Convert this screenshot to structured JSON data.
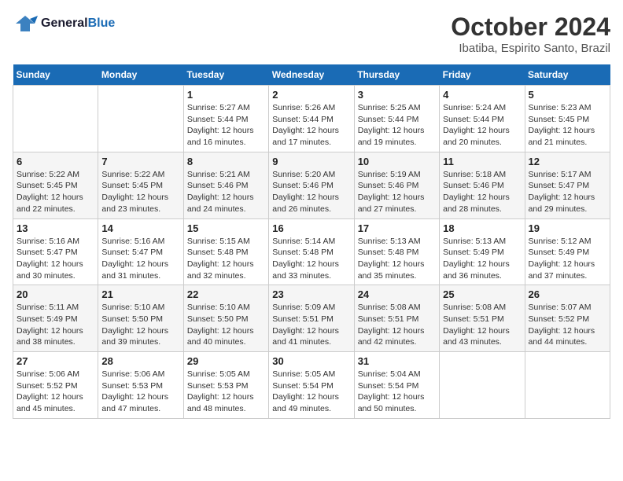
{
  "header": {
    "logo_line1": "General",
    "logo_line2": "Blue",
    "month": "October 2024",
    "location": "Ibatiba, Espirito Santo, Brazil"
  },
  "days_of_week": [
    "Sunday",
    "Monday",
    "Tuesday",
    "Wednesday",
    "Thursday",
    "Friday",
    "Saturday"
  ],
  "weeks": [
    [
      {
        "num": "",
        "sunrise": "",
        "sunset": "",
        "daylight": ""
      },
      {
        "num": "",
        "sunrise": "",
        "sunset": "",
        "daylight": ""
      },
      {
        "num": "1",
        "sunrise": "Sunrise: 5:27 AM",
        "sunset": "Sunset: 5:44 PM",
        "daylight": "Daylight: 12 hours and 16 minutes."
      },
      {
        "num": "2",
        "sunrise": "Sunrise: 5:26 AM",
        "sunset": "Sunset: 5:44 PM",
        "daylight": "Daylight: 12 hours and 17 minutes."
      },
      {
        "num": "3",
        "sunrise": "Sunrise: 5:25 AM",
        "sunset": "Sunset: 5:44 PM",
        "daylight": "Daylight: 12 hours and 19 minutes."
      },
      {
        "num": "4",
        "sunrise": "Sunrise: 5:24 AM",
        "sunset": "Sunset: 5:44 PM",
        "daylight": "Daylight: 12 hours and 20 minutes."
      },
      {
        "num": "5",
        "sunrise": "Sunrise: 5:23 AM",
        "sunset": "Sunset: 5:45 PM",
        "daylight": "Daylight: 12 hours and 21 minutes."
      }
    ],
    [
      {
        "num": "6",
        "sunrise": "Sunrise: 5:22 AM",
        "sunset": "Sunset: 5:45 PM",
        "daylight": "Daylight: 12 hours and 22 minutes."
      },
      {
        "num": "7",
        "sunrise": "Sunrise: 5:22 AM",
        "sunset": "Sunset: 5:45 PM",
        "daylight": "Daylight: 12 hours and 23 minutes."
      },
      {
        "num": "8",
        "sunrise": "Sunrise: 5:21 AM",
        "sunset": "Sunset: 5:46 PM",
        "daylight": "Daylight: 12 hours and 24 minutes."
      },
      {
        "num": "9",
        "sunrise": "Sunrise: 5:20 AM",
        "sunset": "Sunset: 5:46 PM",
        "daylight": "Daylight: 12 hours and 26 minutes."
      },
      {
        "num": "10",
        "sunrise": "Sunrise: 5:19 AM",
        "sunset": "Sunset: 5:46 PM",
        "daylight": "Daylight: 12 hours and 27 minutes."
      },
      {
        "num": "11",
        "sunrise": "Sunrise: 5:18 AM",
        "sunset": "Sunset: 5:46 PM",
        "daylight": "Daylight: 12 hours and 28 minutes."
      },
      {
        "num": "12",
        "sunrise": "Sunrise: 5:17 AM",
        "sunset": "Sunset: 5:47 PM",
        "daylight": "Daylight: 12 hours and 29 minutes."
      }
    ],
    [
      {
        "num": "13",
        "sunrise": "Sunrise: 5:16 AM",
        "sunset": "Sunset: 5:47 PM",
        "daylight": "Daylight: 12 hours and 30 minutes."
      },
      {
        "num": "14",
        "sunrise": "Sunrise: 5:16 AM",
        "sunset": "Sunset: 5:47 PM",
        "daylight": "Daylight: 12 hours and 31 minutes."
      },
      {
        "num": "15",
        "sunrise": "Sunrise: 5:15 AM",
        "sunset": "Sunset: 5:48 PM",
        "daylight": "Daylight: 12 hours and 32 minutes."
      },
      {
        "num": "16",
        "sunrise": "Sunrise: 5:14 AM",
        "sunset": "Sunset: 5:48 PM",
        "daylight": "Daylight: 12 hours and 33 minutes."
      },
      {
        "num": "17",
        "sunrise": "Sunrise: 5:13 AM",
        "sunset": "Sunset: 5:48 PM",
        "daylight": "Daylight: 12 hours and 35 minutes."
      },
      {
        "num": "18",
        "sunrise": "Sunrise: 5:13 AM",
        "sunset": "Sunset: 5:49 PM",
        "daylight": "Daylight: 12 hours and 36 minutes."
      },
      {
        "num": "19",
        "sunrise": "Sunrise: 5:12 AM",
        "sunset": "Sunset: 5:49 PM",
        "daylight": "Daylight: 12 hours and 37 minutes."
      }
    ],
    [
      {
        "num": "20",
        "sunrise": "Sunrise: 5:11 AM",
        "sunset": "Sunset: 5:49 PM",
        "daylight": "Daylight: 12 hours and 38 minutes."
      },
      {
        "num": "21",
        "sunrise": "Sunrise: 5:10 AM",
        "sunset": "Sunset: 5:50 PM",
        "daylight": "Daylight: 12 hours and 39 minutes."
      },
      {
        "num": "22",
        "sunrise": "Sunrise: 5:10 AM",
        "sunset": "Sunset: 5:50 PM",
        "daylight": "Daylight: 12 hours and 40 minutes."
      },
      {
        "num": "23",
        "sunrise": "Sunrise: 5:09 AM",
        "sunset": "Sunset: 5:51 PM",
        "daylight": "Daylight: 12 hours and 41 minutes."
      },
      {
        "num": "24",
        "sunrise": "Sunrise: 5:08 AM",
        "sunset": "Sunset: 5:51 PM",
        "daylight": "Daylight: 12 hours and 42 minutes."
      },
      {
        "num": "25",
        "sunrise": "Sunrise: 5:08 AM",
        "sunset": "Sunset: 5:51 PM",
        "daylight": "Daylight: 12 hours and 43 minutes."
      },
      {
        "num": "26",
        "sunrise": "Sunrise: 5:07 AM",
        "sunset": "Sunset: 5:52 PM",
        "daylight": "Daylight: 12 hours and 44 minutes."
      }
    ],
    [
      {
        "num": "27",
        "sunrise": "Sunrise: 5:06 AM",
        "sunset": "Sunset: 5:52 PM",
        "daylight": "Daylight: 12 hours and 45 minutes."
      },
      {
        "num": "28",
        "sunrise": "Sunrise: 5:06 AM",
        "sunset": "Sunset: 5:53 PM",
        "daylight": "Daylight: 12 hours and 47 minutes."
      },
      {
        "num": "29",
        "sunrise": "Sunrise: 5:05 AM",
        "sunset": "Sunset: 5:53 PM",
        "daylight": "Daylight: 12 hours and 48 minutes."
      },
      {
        "num": "30",
        "sunrise": "Sunrise: 5:05 AM",
        "sunset": "Sunset: 5:54 PM",
        "daylight": "Daylight: 12 hours and 49 minutes."
      },
      {
        "num": "31",
        "sunrise": "Sunrise: 5:04 AM",
        "sunset": "Sunset: 5:54 PM",
        "daylight": "Daylight: 12 hours and 50 minutes."
      },
      {
        "num": "",
        "sunrise": "",
        "sunset": "",
        "daylight": ""
      },
      {
        "num": "",
        "sunrise": "",
        "sunset": "",
        "daylight": ""
      }
    ]
  ]
}
